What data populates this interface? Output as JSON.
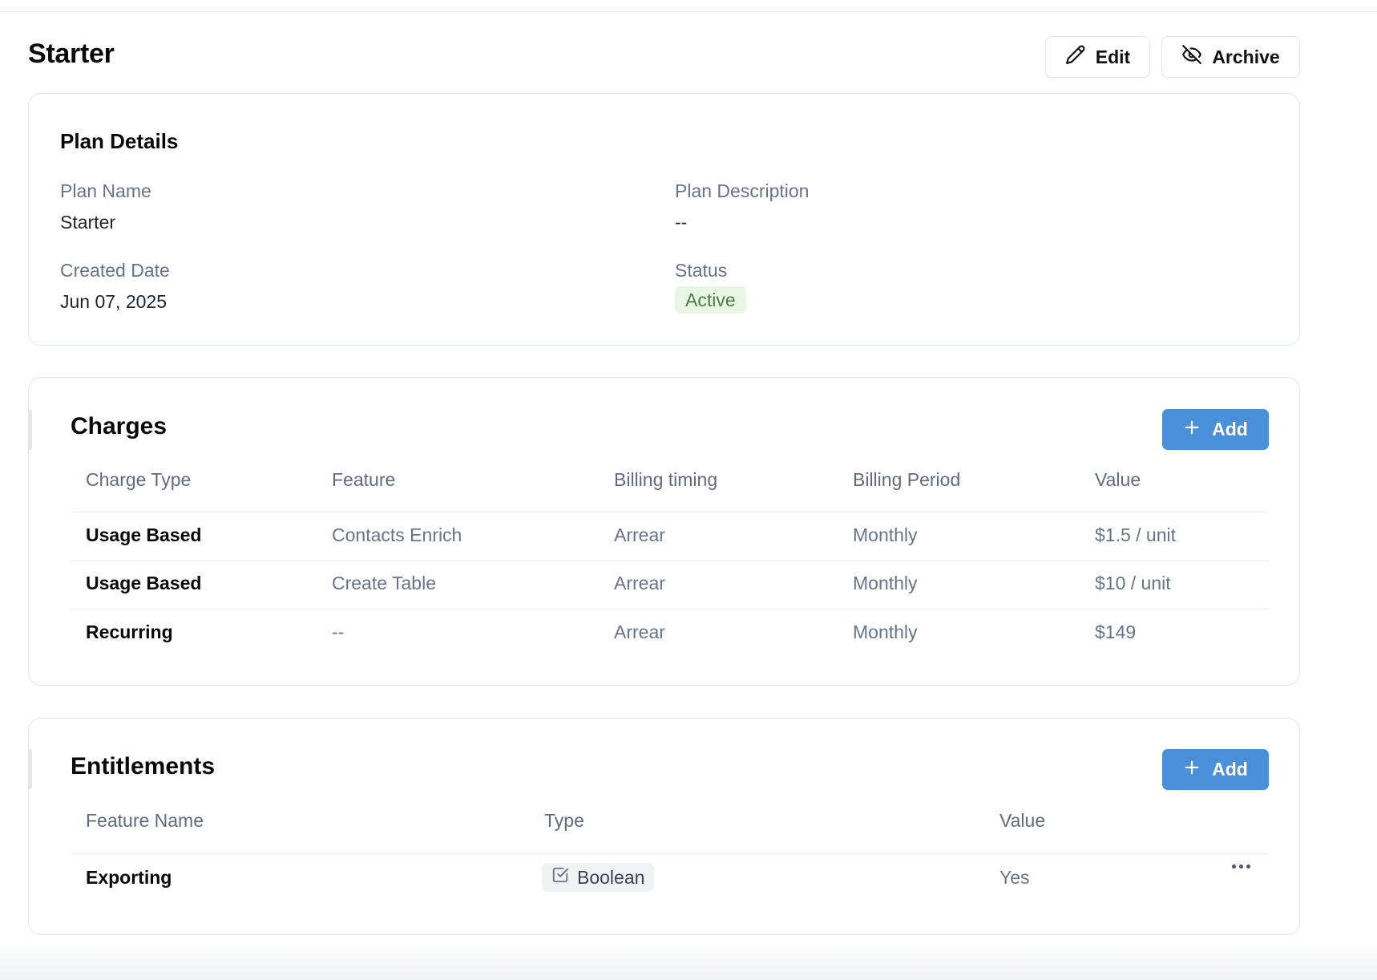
{
  "header": {
    "title": "Starter",
    "edit_label": "Edit",
    "archive_label": "Archive"
  },
  "plan_details": {
    "title": "Plan Details",
    "plan_name_label": "Plan Name",
    "plan_name_value": "Starter",
    "plan_description_label": "Plan Description",
    "plan_description_value": "--",
    "created_date_label": "Created Date",
    "created_date_value": "Jun 07, 2025",
    "status_label": "Status",
    "status_value": "Active"
  },
  "charges": {
    "title": "Charges",
    "add_label": "Add",
    "columns": [
      "Charge Type",
      "Feature",
      "Billing timing",
      "Billing Period",
      "Value"
    ],
    "rows": [
      [
        "Usage Based",
        "Contacts Enrich",
        "Arrear",
        "Monthly",
        "$1.5 / unit"
      ],
      [
        "Usage Based",
        "Create Table",
        "Arrear",
        "Monthly",
        "$10 / unit"
      ],
      [
        "Recurring",
        "--",
        "Arrear",
        "Monthly",
        "$149"
      ]
    ]
  },
  "entitlements": {
    "title": "Entitlements",
    "add_label": "Add",
    "columns": [
      "Feature Name",
      "Type",
      "Value"
    ],
    "rows": [
      [
        "Exporting",
        "Boolean",
        "Yes"
      ]
    ]
  },
  "colors": {
    "primary_button": "#4a8fd9",
    "active_badge_bg": "#eaf6e5",
    "active_badge_text": "#4d7a43"
  },
  "icons": {
    "edit": "pencil-icon",
    "archive": "eye-off-icon",
    "add": "plus-icon",
    "boolean_type": "checkbox-icon",
    "row_actions": "more-horizontal-icon"
  }
}
